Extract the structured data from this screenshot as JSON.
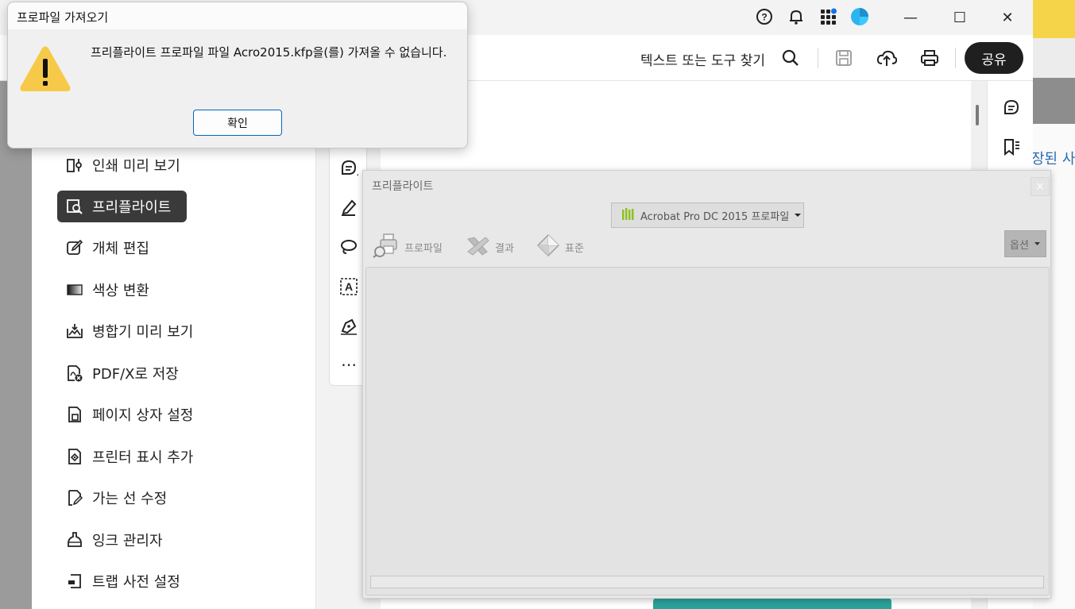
{
  "titlebar": {
    "icons": [
      "help-icon",
      "bell-icon",
      "apps-icon",
      "profile-avatar-icon"
    ],
    "window_controls": {
      "minimize": "—",
      "maximize": "☐",
      "close": "✕"
    }
  },
  "toolbar": {
    "find_label": "텍스트 또는 도구 찾기",
    "icons": [
      "search-icon",
      "save-icon",
      "upload-cloud-icon",
      "print-icon"
    ],
    "share_label": "공유"
  },
  "left_menu": {
    "items": [
      {
        "label": "인쇄 미리 보기",
        "icon": "print-preview-icon",
        "active": false
      },
      {
        "label": "프리플라이트",
        "icon": "preflight-icon",
        "active": true
      },
      {
        "label": "개체 편집",
        "icon": "edit-object-icon",
        "active": false
      },
      {
        "label": "색상 변환",
        "icon": "convert-colors-icon",
        "active": false
      },
      {
        "label": "병합기 미리 보기",
        "icon": "flattener-preview-icon",
        "active": false
      },
      {
        "label": "PDF/X로 저장",
        "icon": "save-pdfx-icon",
        "active": false
      },
      {
        "label": "페이지 상자 설정",
        "icon": "page-box-icon",
        "active": false
      },
      {
        "label": "프린터 표시 추가",
        "icon": "printer-marks-icon",
        "active": false
      },
      {
        "label": "가는 선 수정",
        "icon": "fix-hairlines-icon",
        "active": false
      },
      {
        "label": "잉크 관리자",
        "icon": "ink-manager-icon",
        "active": false
      },
      {
        "label": "트랩 사전 설정",
        "icon": "trap-presets-icon",
        "active": false
      }
    ]
  },
  "quick_tools": {
    "icons": [
      "comment-icon",
      "highlight-pen-icon",
      "lasso-draw-icon",
      "text-box-icon",
      "signature-pen-icon",
      "more-icon"
    ],
    "more_label": "⋯"
  },
  "right_rail": {
    "icons": [
      "comments-panel-icon",
      "bookmarks-panel-icon"
    ]
  },
  "background_text": "장된 사",
  "preflight": {
    "title": "프리플라이트",
    "close_label": "×",
    "profile_select": "Acrobat Pro DC 2015 프로파일",
    "tabs": [
      {
        "label": "프로파일",
        "icon": "profiles-printer-magnifier-icon"
      },
      {
        "label": "결과",
        "icon": "results-x-icon"
      },
      {
        "label": "표준",
        "icon": "standards-diamond-icon"
      }
    ],
    "options_label": "옵션"
  },
  "import_dialog": {
    "title": "프로파일 가져오기",
    "message": "프리플라이트 프로파일 파일 Acro2015.kfp을(를) 가져올 수 없습니다.",
    "ok_label": "확인"
  },
  "colors": {
    "desktop_yellow": "#f6d44a",
    "share_button_bg": "#1f1f1f",
    "active_menu_bg": "#3a3a3a",
    "ok_button_border": "#0067c0",
    "warning_yellow": "#f7c948",
    "profile_green": "#8dc21f",
    "teal_art": "#2aa39a"
  }
}
